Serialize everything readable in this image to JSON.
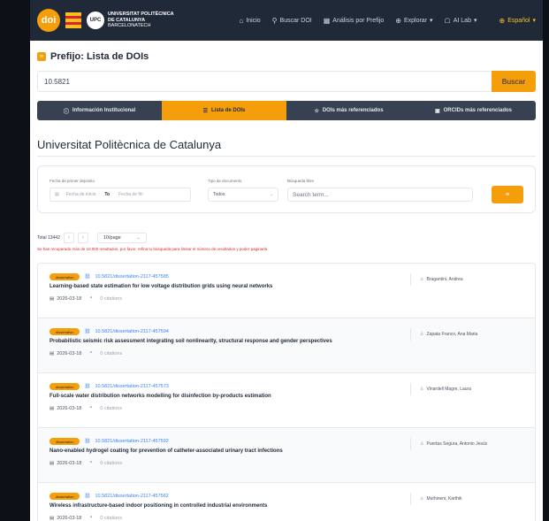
{
  "navbar": {
    "logo": "doi",
    "university": {
      "line1": "UNIVERSITAT POLITÈCNICA",
      "line2": "DE CATALUNYA",
      "line3": "BARCELONATECH",
      "upc": "UPC"
    },
    "links": [
      {
        "label": "Inicio",
        "icon": "home-icon"
      },
      {
        "label": "Buscar DOI",
        "icon": "search-icon"
      },
      {
        "label": "Análisis por Prefijo",
        "icon": "chart-icon"
      },
      {
        "label": "Explorar",
        "icon": "globe-icon"
      },
      {
        "label": "AI Lab",
        "icon": "robot-icon"
      }
    ],
    "language": "Español"
  },
  "page": {
    "title": "Prefijo: Lista de DOIs",
    "search_value": "10.5821",
    "search_button": "Buscar"
  },
  "tabs": [
    {
      "label": "Información Institucional",
      "icon": "info-icon",
      "active": false
    },
    {
      "label": "Lista de DOIs",
      "icon": "list-icon",
      "active": true
    },
    {
      "label": "DOIs más referenciados",
      "icon": "star-icon",
      "active": false
    },
    {
      "label": "ORCIDs más referenciados",
      "icon": "id-icon",
      "active": false
    }
  ],
  "section_title": "Universitat Politècnica de Catalunya",
  "filters": {
    "date_label": "Fecha de primer depósito",
    "date_start_placeholder": "Fecha de inicio",
    "date_to": "To",
    "date_end_placeholder": "Fecha de fin",
    "type_label": "Tipo de documento",
    "type_value": "Todos",
    "free_label": "Búsqueda libre",
    "free_placeholder": "Search term..."
  },
  "pagination": {
    "total": "Total 13442",
    "page_size": "10/page",
    "warning": "Se han recuperado más de 10.000 resultados, por favor, refina tu búsqueda para limitar el número de resultados y poder paginarla"
  },
  "results": [
    {
      "type": "dissertation",
      "doi": "10.5821/dissertation-2117-457585",
      "title": "Learning-based state estimation for low voltage distribution grids using neural networks",
      "date": "2026-03-18",
      "citations": "0 citations",
      "author": "Bragantini, Andrea"
    },
    {
      "type": "dissertation",
      "doi": "10.5821/dissertation-2117-457594",
      "title": "Probabilistic seismic risk assessment integrating soil nonlinearity, structural response and gender perspectives",
      "date": "2026-03-18",
      "citations": "0 citations",
      "author": "Zapata Franco, Ana Maria"
    },
    {
      "type": "dissertation",
      "doi": "10.5821/dissertation-2117-457573",
      "title": "Full-scale water distribution networks modelling for disinfection by-products estimation",
      "date": "2026-03-18",
      "citations": "0 citations",
      "author": "Vinardell Magre, Laura"
    },
    {
      "type": "dissertation",
      "doi": "10.5821/dissertation-2117-457592",
      "title": "Nano-enabled hydrogel coating for prevention of catheter-associated urinary tract infections",
      "date": "2026-03-18",
      "citations": "0 citations",
      "author": "Puertas Segura, Antonio Jesús"
    },
    {
      "type": "dissertation",
      "doi": "10.5821/dissertation-2117-457562",
      "title": "Wireless infrastructure-based indoor positioning in controlled industrial environments",
      "date": "2026-03-18",
      "citations": "0 citations",
      "author": "Muthineni, Karthik"
    }
  ],
  "colors": {
    "accent": "#f59e0b",
    "nav_bg": "#1f2937",
    "link": "#3b82f6",
    "warning": "#dc2626"
  }
}
